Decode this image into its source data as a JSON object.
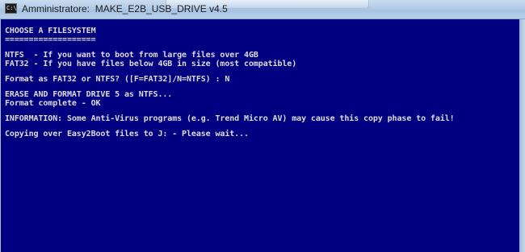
{
  "window": {
    "title_prefix": "Amministratore:",
    "title_name": "MAKE_E2B_USB_DRIVE v4.5",
    "icon_glyph": "C:\\"
  },
  "colors": {
    "console_background": "#000080",
    "console_text": "#dcdcdc",
    "titlebar": "#b3cbe6"
  },
  "console": {
    "heading": "CHOOSE A FILESYSTEM",
    "heading_rule": "===================",
    "ntfs_option": "NTFS  - If you want to boot from large files over 4GB",
    "fat32_option": "FAT32 - If you have files below 4GB in size (most compatible)",
    "format_prompt": "Format as FAT32 or NTFS? ([F=FAT32]/N=NTFS) : N",
    "erase_message": "ERASE AND FORMAT DRIVE 5 as NTFS...",
    "format_complete": "Format complete - OK",
    "information": "INFORMATION: Some Anti-Virus programs (e.g. Trend Micro AV) may cause this copy phase to fail!",
    "copying": "Copying over Easy2Boot files to J: - Please wait..."
  }
}
